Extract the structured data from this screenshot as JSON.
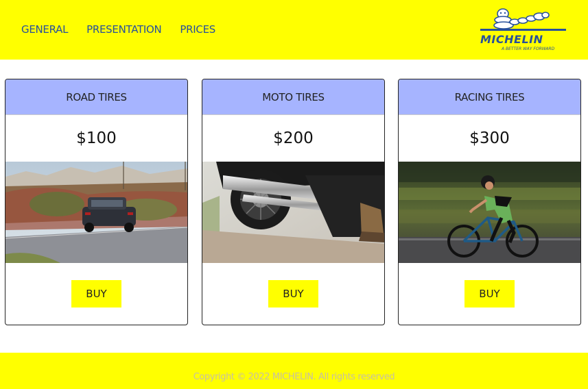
{
  "nav": {
    "items": [
      {
        "label": "GENERAL"
      },
      {
        "label": "PRESENTATION"
      },
      {
        "label": "PRICES"
      }
    ]
  },
  "logo": {
    "brand": "MICHELIN",
    "tagline": "A BETTER WAY FORWARD"
  },
  "products": [
    {
      "title": "ROAD TIRES",
      "price": "$100",
      "image": "suv-on-road-photo",
      "button": "BUY"
    },
    {
      "title": "MOTO TIRES",
      "price": "$200",
      "image": "motorcycle-wheel-photo",
      "button": "BUY"
    },
    {
      "title": "RACING TIRES",
      "price": "$300",
      "image": "cyclist-photo",
      "button": "BUY"
    }
  ],
  "footer": {
    "copyright": "Copyright © 2022 MICHELIN. All rights reserved"
  },
  "colors": {
    "brand_yellow": "#ffff00",
    "brand_blue": "#27509b",
    "card_header": "#a6b4ff"
  }
}
